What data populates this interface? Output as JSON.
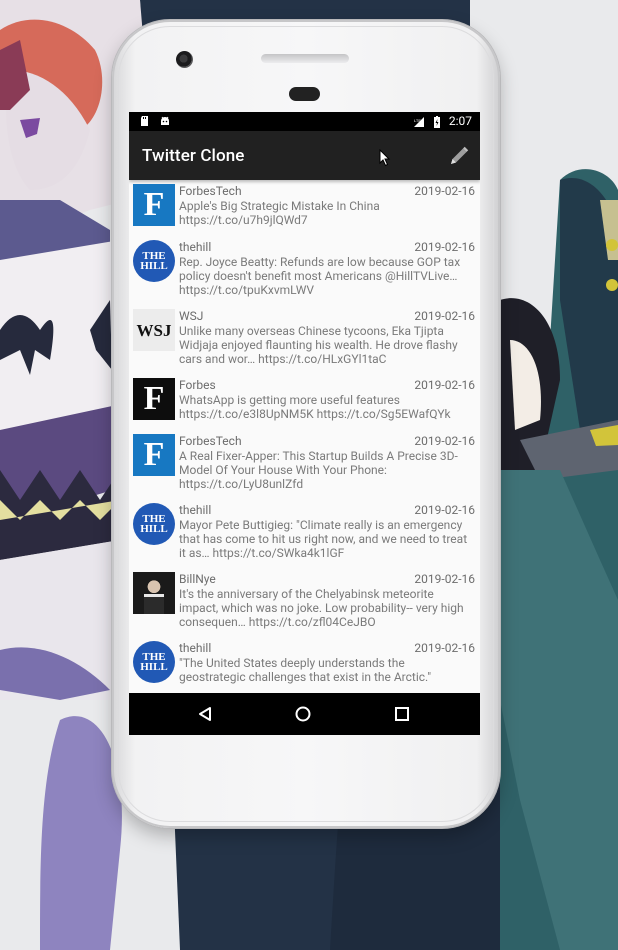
{
  "status_bar": {
    "time": "2:07",
    "network": "LTE"
  },
  "app_bar": {
    "title": "Twitter Clone",
    "compose_icon": "pencil-icon"
  },
  "tweets": [
    {
      "handle": "ForbesTech",
      "date": "2019-02-16",
      "text": "Apple's Big Strategic Mistake In China https://t.co/u7h9jlQWd7",
      "avatar": "forbes-blue",
      "letter": "F"
    },
    {
      "handle": "thehill",
      "date": "2019-02-16",
      "text": "Rep. Joyce Beatty: Refunds are low because GOP tax policy doesn't benefit most Americans @HillTVLive… https://t.co/tpuKxvmLWV",
      "avatar": "thehill",
      "letter": "THE HILL"
    },
    {
      "handle": "WSJ",
      "date": "2019-02-16",
      "text": "Unlike many overseas Chinese tycoons, Eka Tjipta Widjaja enjoyed flaunting his wealth. He drove flashy cars and wor… https://t.co/HLxGYl1taC",
      "avatar": "wsj",
      "letter": "WSJ"
    },
    {
      "handle": "Forbes",
      "date": "2019-02-16",
      "text": "WhatsApp is getting more useful features https://t.co/e3l8UpNM5K https://t.co/Sg5EWafQYk",
      "avatar": "forbes-black",
      "letter": "F"
    },
    {
      "handle": "ForbesTech",
      "date": "2019-02-16",
      "text": "A Real Fixer-Apper: This Startup Builds A Precise 3D-Model Of Your House With Your Phone: https://t.co/LyU8unlZfd",
      "avatar": "forbes-blue",
      "letter": "F"
    },
    {
      "handle": "thehill",
      "date": "2019-02-16",
      "text": "Mayor Pete Buttigieg: \"Climate really is an emergency that has come to hit us right now, and we need to treat it as… https://t.co/SWka4k1lGF",
      "avatar": "thehill",
      "letter": "THE HILL"
    },
    {
      "handle": "BillNye",
      "date": "2019-02-16",
      "text": "It's the anniversary of the Chelyabinsk meteorite impact, which was no joke. Low probability-- very high consequen… https://t.co/zfl04CeJBO",
      "avatar": "photo",
      "letter": ""
    },
    {
      "handle": "thehill",
      "date": "2019-02-16",
      "text": "\"The United States deeply understands the geostrategic challenges that exist in the Arctic.\"",
      "avatar": "thehill",
      "letter": "THE HILL"
    }
  ],
  "colors": {
    "app_bar": "#212121",
    "status_bar": "#000000",
    "forbes_blue": "#1778c2",
    "thehill_blue": "#2159b5",
    "text_gray": "#7a7a7a"
  },
  "nav": {
    "back_icon": "back-triangle-icon",
    "home_icon": "home-circle-icon",
    "recents_icon": "recents-square-icon"
  }
}
